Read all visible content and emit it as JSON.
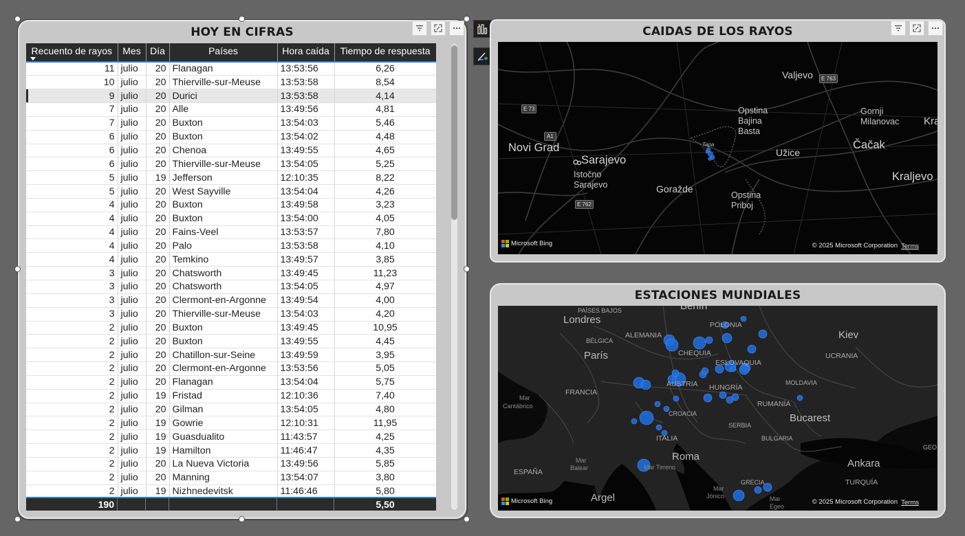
{
  "table_visual": {
    "title": "HOY EN CIFRAS",
    "columns": [
      "Recuento de rayos",
      "Mes",
      "Día",
      "Países",
      "Hora caída",
      "Tiempo de respuesta"
    ],
    "rows": [
      [
        "11",
        "julio",
        "20",
        "Flanagan",
        "13:53:56",
        "6,26"
      ],
      [
        "10",
        "julio",
        "20",
        "Thierville-sur-Meuse",
        "13:53:58",
        "8,54"
      ],
      [
        "9",
        "julio",
        "20",
        "Durici",
        "13:53:58",
        "4,14"
      ],
      [
        "7",
        "julio",
        "20",
        "Alle",
        "13:49:56",
        "4,81"
      ],
      [
        "7",
        "julio",
        "20",
        "Buxton",
        "13:54:03",
        "5,46"
      ],
      [
        "6",
        "julio",
        "20",
        "Buxton",
        "13:54:02",
        "4,48"
      ],
      [
        "6",
        "julio",
        "20",
        "Chenoa",
        "13:49:55",
        "4,65"
      ],
      [
        "6",
        "julio",
        "20",
        "Thierville-sur-Meuse",
        "13:54:05",
        "5,25"
      ],
      [
        "5",
        "julio",
        "19",
        "Jefferson",
        "12:10:35",
        "8,22"
      ],
      [
        "5",
        "julio",
        "20",
        "West Sayville",
        "13:54:04",
        "4,26"
      ],
      [
        "4",
        "julio",
        "20",
        "Buxton",
        "13:49:58",
        "3,23"
      ],
      [
        "4",
        "julio",
        "20",
        "Buxton",
        "13:54:00",
        "4,05"
      ],
      [
        "4",
        "julio",
        "20",
        "Fains-Veel",
        "13:53:57",
        "7,80"
      ],
      [
        "4",
        "julio",
        "20",
        "Palo",
        "13:53:58",
        "4,10"
      ],
      [
        "4",
        "julio",
        "20",
        "Temkino",
        "13:49:57",
        "3,85"
      ],
      [
        "3",
        "julio",
        "20",
        "Chatsworth",
        "13:49:45",
        "11,23"
      ],
      [
        "3",
        "julio",
        "20",
        "Chatsworth",
        "13:54:05",
        "4,97"
      ],
      [
        "3",
        "julio",
        "20",
        "Clermont-en-Argonne",
        "13:49:54",
        "4,00"
      ],
      [
        "3",
        "julio",
        "20",
        "Thierville-sur-Meuse",
        "13:54:03",
        "4,20"
      ],
      [
        "2",
        "julio",
        "20",
        "Buxton",
        "13:49:45",
        "10,95"
      ],
      [
        "2",
        "julio",
        "20",
        "Buxton",
        "13:49:55",
        "4,45"
      ],
      [
        "2",
        "julio",
        "20",
        "Chatillon-sur-Seine",
        "13:49:59",
        "3,95"
      ],
      [
        "2",
        "julio",
        "20",
        "Clermont-en-Argonne",
        "13:53:56",
        "5,05"
      ],
      [
        "2",
        "julio",
        "20",
        "Flanagan",
        "13:54:04",
        "5,75"
      ],
      [
        "2",
        "julio",
        "19",
        "Fristad",
        "12:10:36",
        "7,40"
      ],
      [
        "2",
        "julio",
        "20",
        "Gilman",
        "13:54:05",
        "4,80"
      ],
      [
        "2",
        "julio",
        "19",
        "Gowrie",
        "12:10:31",
        "11,95"
      ],
      [
        "2",
        "julio",
        "19",
        "Guasdualito",
        "11:43:57",
        "4,25"
      ],
      [
        "2",
        "julio",
        "19",
        "Hamilton",
        "11:46:47",
        "4,35"
      ],
      [
        "2",
        "julio",
        "20",
        "La Nueva Victoria",
        "13:49:56",
        "5,85"
      ],
      [
        "2",
        "julio",
        "20",
        "Manning",
        "13:54:07",
        "3,80"
      ],
      [
        "2",
        "julio",
        "19",
        "Nizhnedevitsk",
        "11:46:46",
        "5,80"
      ]
    ],
    "selected_row": 2,
    "totals": [
      "190",
      "",
      "",
      "",
      "",
      "5,50"
    ]
  },
  "map1": {
    "title": "CAIDAS DE LOS RAYOS",
    "labels": [
      {
        "text": "Valjevo",
        "size": "m"
      },
      {
        "text": "E 763",
        "size": "shield"
      },
      {
        "text": "E 73",
        "size": "shield"
      },
      {
        "text": "A1",
        "size": "shield"
      },
      {
        "text": "Opstina",
        "size": "s"
      },
      {
        "text": "Bajina",
        "size": "s"
      },
      {
        "text": "Basta",
        "size": "s"
      },
      {
        "text": "Gornji",
        "size": "s"
      },
      {
        "text": "Milanovac",
        "size": "s"
      },
      {
        "text": "Kra",
        "size": "m"
      },
      {
        "text": "Novi Grad",
        "size": "l"
      },
      {
        "text": "Sarajevo",
        "size": "l"
      },
      {
        "text": "Užice",
        "size": "m"
      },
      {
        "text": "Čačak",
        "size": "l"
      },
      {
        "text": "Istočno",
        "size": "s"
      },
      {
        "text": "Sarajevo",
        "size": "s"
      },
      {
        "text": "Goražde",
        "size": "m"
      },
      {
        "text": "Kraljevo",
        "size": "l"
      },
      {
        "text": "E 762",
        "size": "shield"
      },
      {
        "text": "Opstina",
        "size": "s"
      },
      {
        "text": "Priboj",
        "size": "s"
      },
      {
        "text": "Tapa",
        "size": "xs"
      }
    ],
    "bing": "Microsoft Bing",
    "copyright": "© 2025 Microsoft Corporation",
    "terms": "Terms"
  },
  "map2": {
    "title": "ESTACIONES MUNDIALES",
    "labels": [
      {
        "text": "PAÍSES BAJOS",
        "size": "xs"
      },
      {
        "text": "Londres",
        "size": "l"
      },
      {
        "text": "Berlín",
        "size": "l"
      },
      {
        "text": "POLONIA",
        "size": "s"
      },
      {
        "text": "BÉLGICA",
        "size": "xs"
      },
      {
        "text": "ALEMANIA",
        "size": "s"
      },
      {
        "text": "Kiev",
        "size": "l"
      },
      {
        "text": "París",
        "size": "l"
      },
      {
        "text": "CHEQUIA",
        "size": "s"
      },
      {
        "text": "ESLOVAQUIA",
        "size": "s"
      },
      {
        "text": "UCRANIA",
        "size": "s"
      },
      {
        "text": "AUSTRIA",
        "size": "s"
      },
      {
        "text": "HUNGRÍA",
        "size": "s"
      },
      {
        "text": "MOLDAVIA",
        "size": "xs"
      },
      {
        "text": "FRANCIA",
        "size": "s"
      },
      {
        "text": "Mar",
        "size": "xs"
      },
      {
        "text": "Cantábrico",
        "size": "xs"
      },
      {
        "text": "CROACIA",
        "size": "xs"
      },
      {
        "text": "RUMANÍA",
        "size": "s"
      },
      {
        "text": "Bucarest",
        "size": "l"
      },
      {
        "text": "SERBIA",
        "size": "xs"
      },
      {
        "text": "ITALIA",
        "size": "s"
      },
      {
        "text": "BULGARIA",
        "size": "xs"
      },
      {
        "text": "Roma",
        "size": "l"
      },
      {
        "text": "Mar",
        "size": "xs"
      },
      {
        "text": "Balear",
        "size": "xs"
      },
      {
        "text": "Mar Tirreno",
        "size": "xs"
      },
      {
        "text": "Ankara",
        "size": "l"
      },
      {
        "text": "GEO",
        "size": "xs"
      },
      {
        "text": "ESPAÑA",
        "size": "s"
      },
      {
        "text": "TURQUÍA",
        "size": "s"
      },
      {
        "text": "GRECIA",
        "size": "xs"
      },
      {
        "text": "Mar",
        "size": "xs"
      },
      {
        "text": "Jónico",
        "size": "xs"
      },
      {
        "text": "Argel",
        "size": "l"
      },
      {
        "text": "Mar",
        "size": "xs"
      },
      {
        "text": "Egeo",
        "size": "xs"
      }
    ],
    "bing": "Microsoft Bing",
    "copyright": "© 2025 Microsoft Corporation",
    "terms": "Terms"
  },
  "icons": {
    "filter": "filter-icon",
    "focus": "focus-mode-icon",
    "more": "more-options-icon",
    "format": "format-visual-icon",
    "analytics": "analytics-icon"
  },
  "colors": {
    "bubble": "#1f6fe0",
    "header": "#2b2b2b",
    "accent": "#2f7fd6"
  }
}
